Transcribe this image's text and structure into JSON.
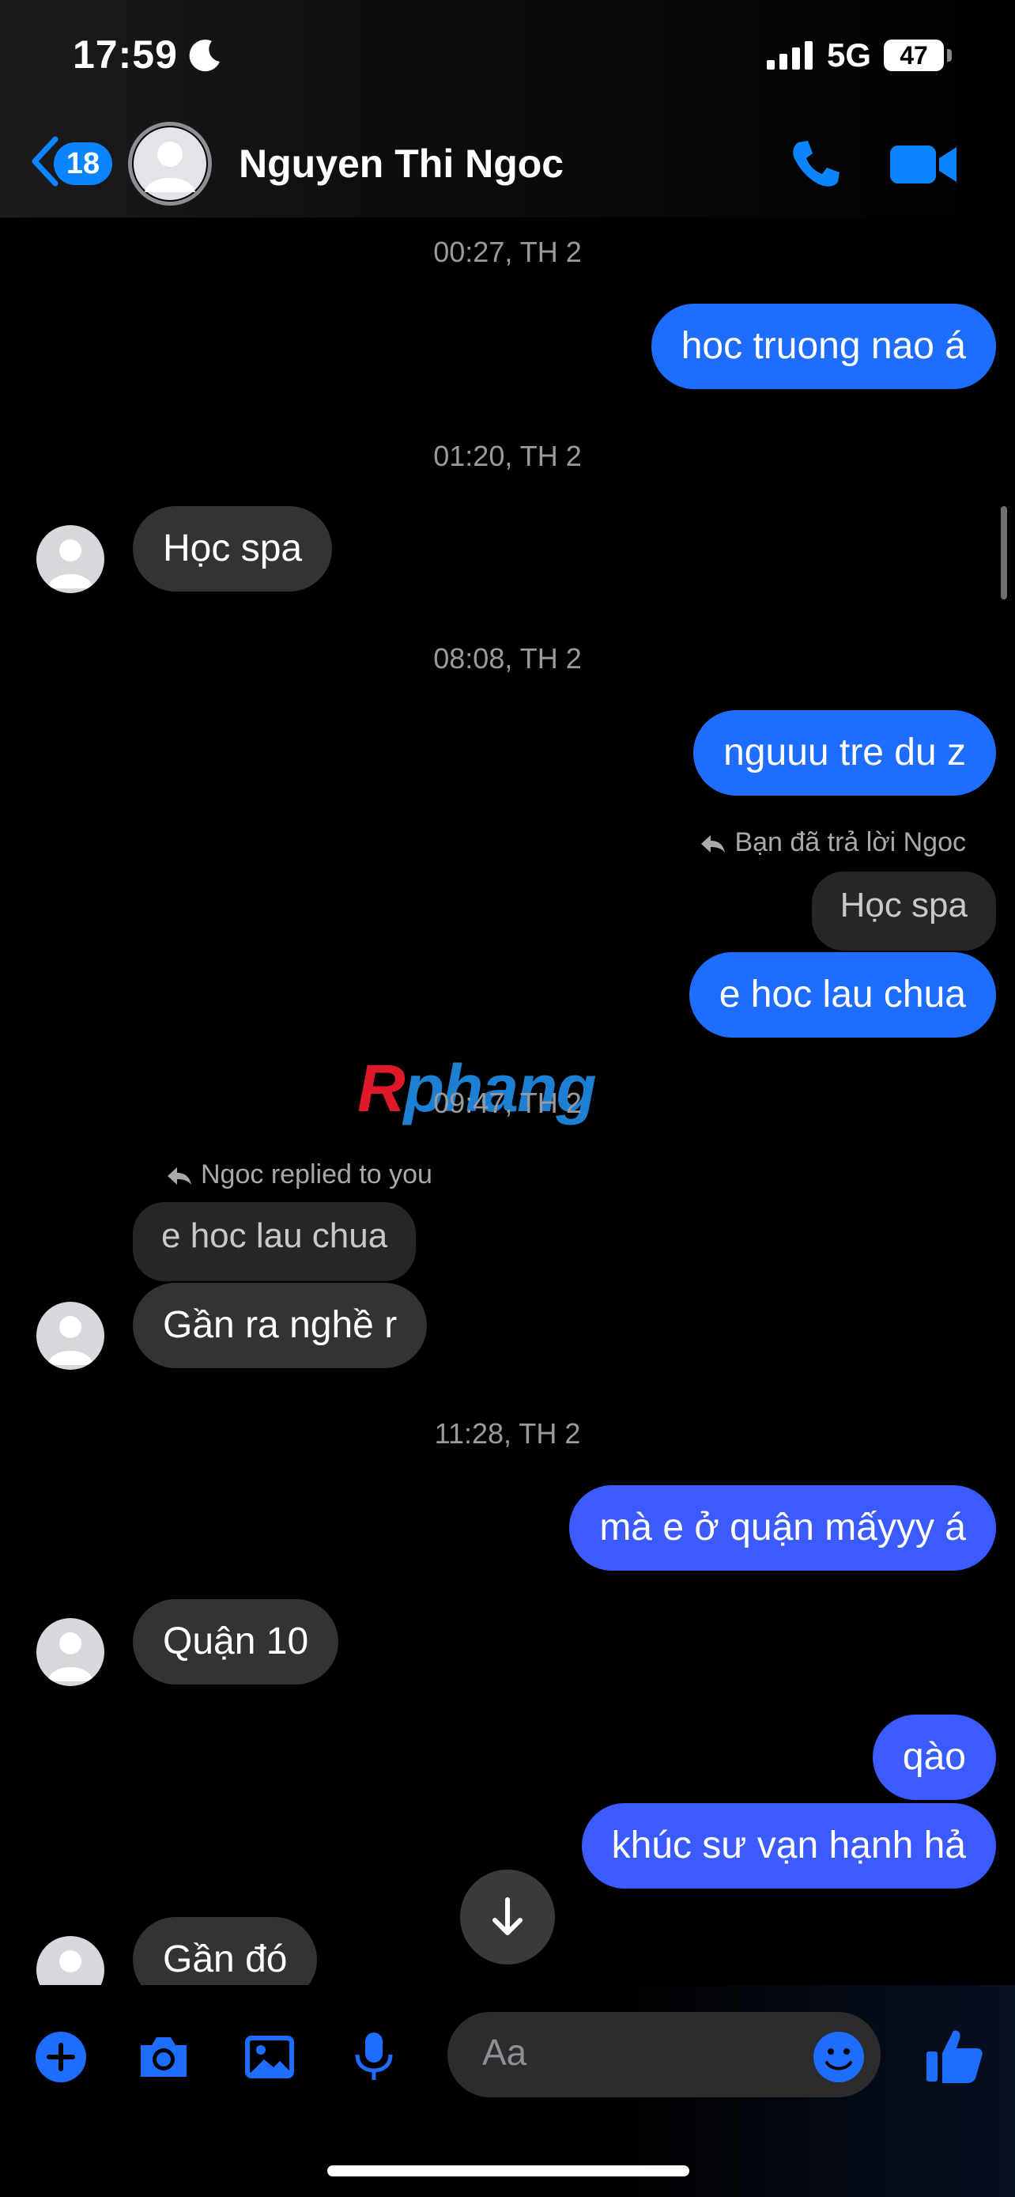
{
  "status_bar": {
    "time": "17:59",
    "network": "5G",
    "battery": "47"
  },
  "header": {
    "back_count": "18",
    "contact_name": "Nguyen Thi Ngoc"
  },
  "messages": {
    "ts1": "00:27, TH 2",
    "m1": "hoc truong nao á",
    "ts2": "01:20, TH 2",
    "m2": "Học spa",
    "ts3": "08:08, TH 2",
    "m3": "nguuu tre du z",
    "reply1_label": "Bạn đã trả lời Ngoc",
    "reply1_quote": "Học spa",
    "m4": "e hoc lau chua",
    "ts4": "09:47, TH 2",
    "reply2_label": "Ngoc replied to you",
    "reply2_quote": "e hoc lau chua",
    "m5": "Gần ra nghề r",
    "ts5": "11:28, TH 2",
    "m6": "mà e ở quận mấyyy á",
    "m7": "Quận 10",
    "m8": "qào",
    "m9": "khúc sư vạn hạnh hả",
    "m10": "Gần đó"
  },
  "watermark": {
    "first": "R",
    "rest": "phang"
  },
  "composer": {
    "placeholder": "Aa"
  },
  "colors": {
    "outgoing": "#1f6dff",
    "outgoing_late": "#3b5bff",
    "incoming": "#333336",
    "accent": "#0a84ff"
  }
}
